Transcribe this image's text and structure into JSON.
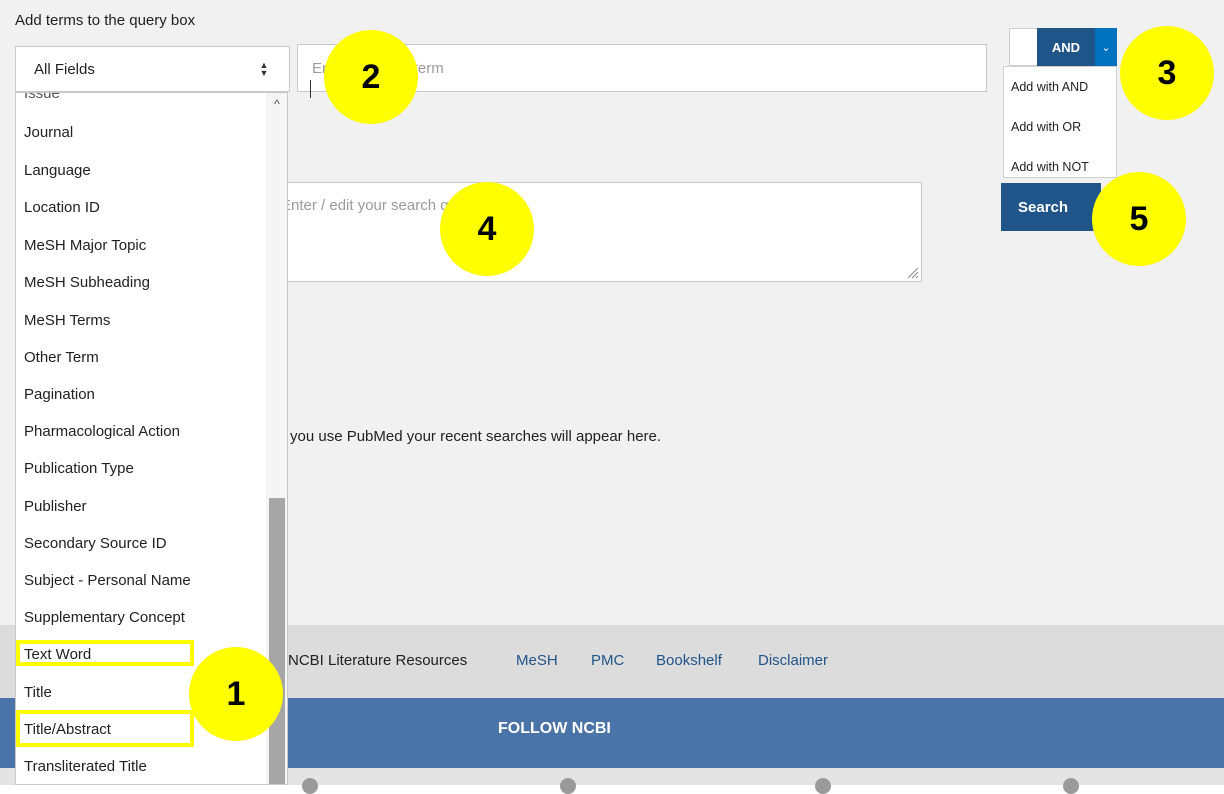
{
  "builder": {
    "heading": "Add terms to the query box",
    "field_select": "All Fields",
    "term_placeholder": "Enter a search term",
    "query_placeholder": "Enter / edit your search query here",
    "history_text": "you use PubMed your recent searches will appear here."
  },
  "field_options": [
    "Issue",
    "Journal",
    "Language",
    "Location ID",
    "MeSH Major Topic",
    "MeSH Subheading",
    "MeSH Terms",
    "Other Term",
    "Pagination",
    "Pharmacological Action",
    "Publication Type",
    "Publisher",
    "Secondary Source ID",
    "Subject - Personal Name",
    "Supplementary Concept",
    "Text Word",
    "Title",
    "Title/Abstract",
    "Transliterated Title"
  ],
  "and_dropdown": {
    "button_label": "AND",
    "options": [
      "Add with AND",
      "Add with OR",
      "Add with NOT"
    ]
  },
  "search_button": "Search",
  "footer": {
    "links": [
      "NCBI Literature Resources",
      "MeSH",
      "PMC",
      "Bookshelf",
      "Disclaimer"
    ],
    "follow": "FOLLOW NCBI"
  },
  "annotations": [
    "1",
    "2",
    "3",
    "4",
    "5"
  ],
  "colors": {
    "highlight": "#ffff00",
    "primary_button": "#20558a",
    "accent": "#0071bc",
    "follow_bar": "#4a73a8"
  }
}
